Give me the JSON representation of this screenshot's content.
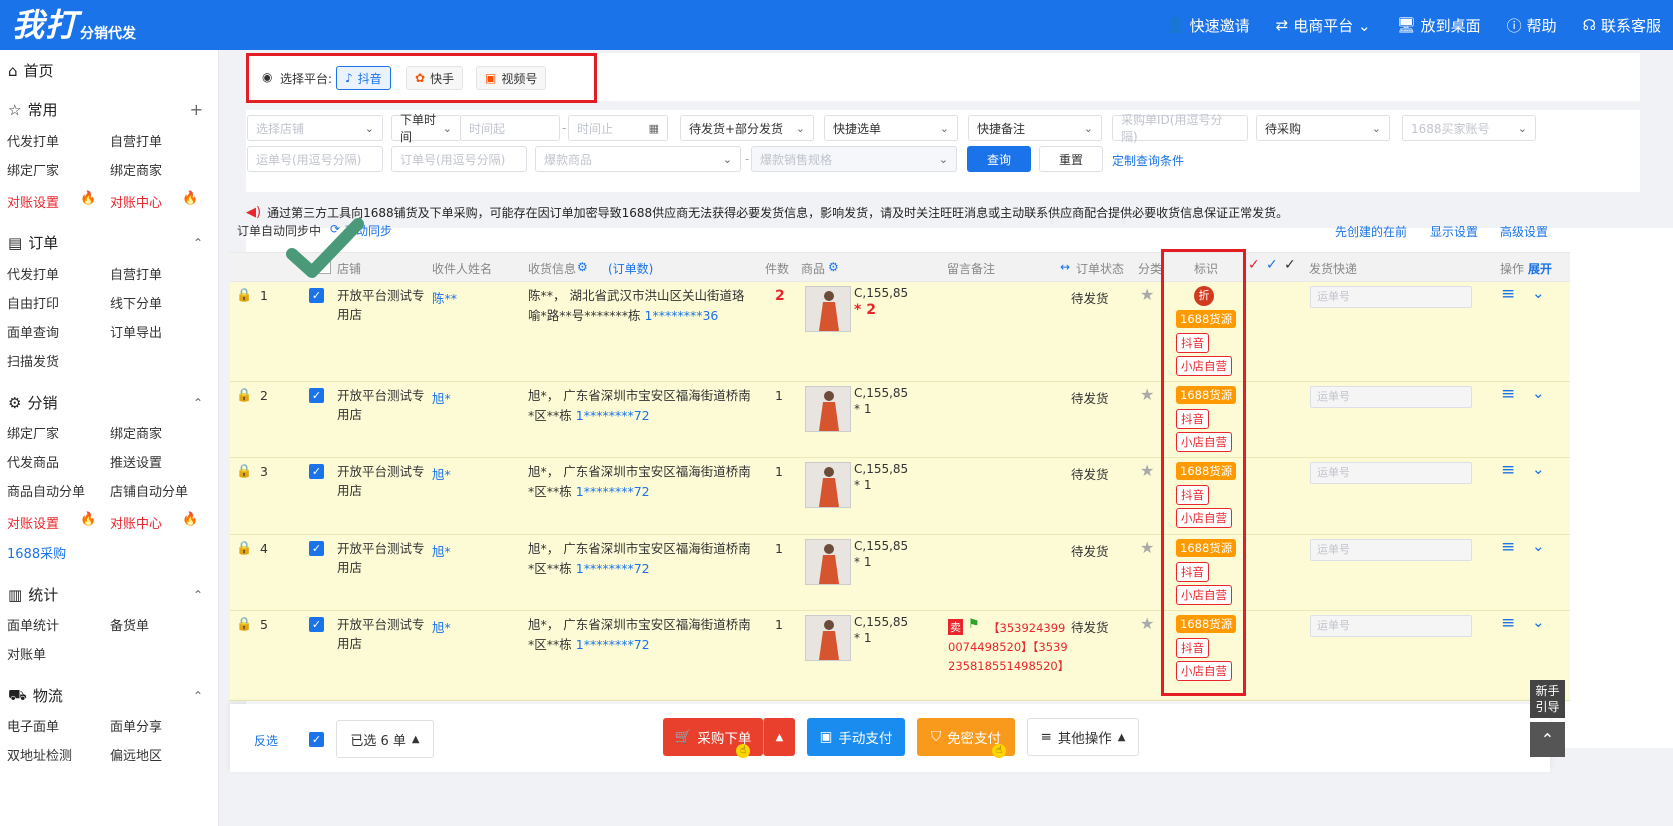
{
  "topbar": {
    "logo_big": "我打",
    "logo_small": "分销代发",
    "nav": [
      {
        "icon": "user-plus-icon",
        "label": "快速邀请"
      },
      {
        "icon": "swap-icon",
        "label": "电商平台 ⌄"
      },
      {
        "icon": "monitor-icon",
        "label": "放到桌面"
      },
      {
        "icon": "help-icon",
        "label": "帮助"
      },
      {
        "icon": "headset-icon",
        "label": "联系客服"
      }
    ]
  },
  "sidebar": {
    "home": "首页",
    "common": "常用",
    "common_add": "+",
    "common_items": [
      "代发打单",
      "自营打单",
      "绑定厂家",
      "绑定商家",
      "对账设置",
      "对账中心"
    ],
    "order": "订单",
    "order_items": [
      "代发打单",
      "自营打单",
      "自由打印",
      "线下分单",
      "面单查询",
      "订单导出",
      "扫描发货"
    ],
    "dist": "分销",
    "dist_items": [
      "绑定厂家",
      "绑定商家",
      "代发商品",
      "推送设置",
      "商品自动分单",
      "店铺自动分单",
      "对账设置",
      "对账中心",
      "1688采购"
    ],
    "stats": "统计",
    "stats_items": [
      "面单统计",
      "备货单",
      "对账单"
    ],
    "logistics": "物流",
    "logistics_items": [
      "电子面单",
      "面单分享",
      "双地址检测",
      "偏远地区"
    ]
  },
  "platform": {
    "label": "选择平台:",
    "options": [
      "抖音",
      "快手",
      "视频号"
    ],
    "selected": "抖音"
  },
  "filters": {
    "shop": "选择店铺",
    "time_type": "下单时间",
    "time_start": "时间起",
    "time_end": "时间止",
    "status": "待发货+部分发货",
    "quick_select": "快捷选单",
    "quick_note": "快捷备注",
    "purchase_id": "采购单ID(用逗号分隔)",
    "purchase_status": "待采购",
    "buyer_account": "1688买家账号",
    "waybill": "运单号(用逗号分隔)",
    "order_no": "订单号(用逗号分隔)",
    "hot_goods": "爆款商品",
    "hot_spec": "爆款销售规格",
    "query": "查询",
    "reset": "重置",
    "custom": "定制查询条件"
  },
  "notice": "通过第三方工具向1688铺货及下单采购，可能存在因订单加密导致1688供应商无法获得必要发货信息，影响发货，请及时关注旺旺消息或主动联系供应商配合提供必要收货信息保证正常发货。",
  "table": {
    "sync_label": "订单自动同步中",
    "sync_link": "手动同步",
    "create_first": "先创建的在前",
    "display": "显示设置",
    "advanced": "高级设置",
    "headers": {
      "shop": "店铺",
      "receiver": "收件人姓名",
      "address": "收货信息",
      "order_count": "(订单数)",
      "qty": "件数",
      "goods": "商品",
      "note": "留言备注",
      "status": "订单状态",
      "category": "分类",
      "mark": "标识",
      "express": "发货快递",
      "ops": "操作",
      "expand": "展开"
    },
    "rows": [
      {
        "no": "1",
        "shop": "开放平台测试专用店",
        "receiver": "陈**",
        "addr1": "陈**，  湖北省武汉市洪山区关山街道珞",
        "addr2": "喻*路**号*******栋",
        "phone": "1********36",
        "qty": "2",
        "spec": "C,155,85",
        "mult": "* 2",
        "note": "",
        "status": "待发货",
        "badges": [
          "折",
          "1688货源",
          "抖音",
          "小店自营"
        ],
        "ship": "运单号"
      },
      {
        "no": "2",
        "shop": "开放平台测试专用店",
        "receiver": "旭*",
        "addr1": "旭*，  广东省深圳市宝安区福海街道桥南",
        "addr2": "*区**栋",
        "phone": "1********72",
        "qty": "1",
        "spec": "C,155,85",
        "mult": "* 1",
        "note": "",
        "status": "待发货",
        "badges": [
          "1688货源",
          "抖音",
          "小店自营"
        ],
        "ship": "运单号"
      },
      {
        "no": "3",
        "shop": "开放平台测试专用店",
        "receiver": "旭*",
        "addr1": "旭*，  广东省深圳市宝安区福海街道桥南",
        "addr2": "*区**栋",
        "phone": "1********72",
        "qty": "1",
        "spec": "C,155,85",
        "mult": "* 1",
        "note": "",
        "status": "待发货",
        "badges": [
          "1688货源",
          "抖音",
          "小店自营"
        ],
        "ship": "运单号"
      },
      {
        "no": "4",
        "shop": "开放平台测试专用店",
        "receiver": "旭*",
        "addr1": "旭*，  广东省深圳市宝安区福海街道桥南",
        "addr2": "*区**栋",
        "phone": "1********72",
        "qty": "1",
        "spec": "C,155,85",
        "mult": "* 1",
        "note": "",
        "status": "待发货",
        "badges": [
          "1688货源",
          "抖音",
          "小店自营"
        ],
        "ship": "运单号"
      },
      {
        "no": "5",
        "shop": "开放平台测试专用店",
        "receiver": "旭*",
        "addr1": "旭*，  广东省深圳市宝安区福海街道桥南",
        "addr2": "*区**栋",
        "phone": "1********72",
        "qty": "1",
        "spec": "C,155,85",
        "mult": "* 1",
        "note": "【3539243990074498520】【3539235818551498520】",
        "note_sell": "卖",
        "status": "待发货",
        "badges": [
          "1688货源",
          "抖音",
          "小店自营"
        ],
        "ship": "运单号"
      }
    ]
  },
  "bottom": {
    "invert": "反选",
    "selected": "已选 6 单",
    "purchase": "采购下单",
    "manual_pay": "手动支付",
    "free_pay": "免密支付",
    "other": "其他操作"
  },
  "guide": "新手引导"
}
